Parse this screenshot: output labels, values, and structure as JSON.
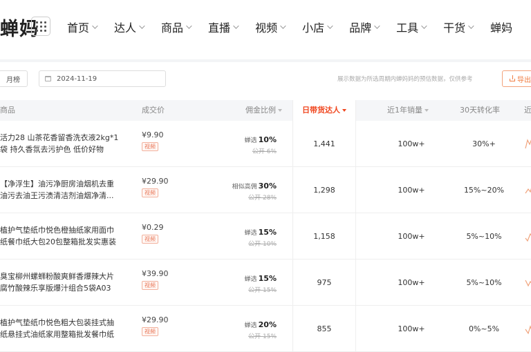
{
  "header": {
    "logo": "蝉妈",
    "nav": [
      "首页",
      "达人",
      "商品",
      "直播",
      "视频",
      "小店",
      "品牌",
      "工具",
      "干货",
      "蝉妈"
    ]
  },
  "filters": {
    "period_button": "月榜",
    "date": "2024-11-19",
    "notice": "展示数据为所选周期内蝉妈妈的预估数据，仅供参考",
    "export_label": "导出"
  },
  "table": {
    "columns": {
      "product": "商品",
      "price": "成交价",
      "commission": "佣金比例",
      "daily_creators": "日带货达人",
      "sales_1y": "近1年销量",
      "conversion_30d": "30天转化率",
      "trend": "近"
    },
    "rows": [
      {
        "name_line1": "活力28 山茶花香留香洗衣液2kg*1",
        "name_line2": "袋 持久香氛去污护色 低价好物",
        "price": "¥9.90",
        "tag": "视频",
        "commission_label": "蝉选",
        "commission_value": "10%",
        "commission_old": "公开 6%",
        "creators": "1,441",
        "sales": "100w+",
        "conversion": "30%+",
        "trend_color": "#f0a37c"
      },
      {
        "name_line1": "【净浮生】油污净厨房油烟机去重",
        "name_line2": "油污去油王污渍清洁剂油烟净清...",
        "price": "¥29.90",
        "tag": "视频",
        "commission_label": "相似高佣",
        "commission_value": "30%",
        "commission_old": "公开 28%",
        "creators": "1,298",
        "sales": "100w+",
        "conversion": "15%~20%",
        "trend_color": "#f0a37c"
      },
      {
        "name_line1": "植护气垫纸巾悦色橙抽纸家用面巾",
        "name_line2": "纸餐巾纸大包20包整箱批发实惠装",
        "price": "¥0.29",
        "tag": "视频",
        "commission_label": "蝉选",
        "commission_value": "15%",
        "commission_old": "公开 10%",
        "creators": "1,158",
        "sales": "100w+",
        "conversion": "5%~10%",
        "trend_color": "#f0a37c"
      },
      {
        "name_line1": "臭宝柳州螺蛳粉酸爽鲜香爆辣大片",
        "name_line2": "腐竹酸辣乐享版爆汁组合5袋A03",
        "price": "¥39.90",
        "tag": "视频",
        "commission_label": "蝉选",
        "commission_value": "15%",
        "commission_old": "公开 15%",
        "creators": "975",
        "sales": "100w+",
        "conversion": "5%~10%",
        "trend_color": "#f0a37c"
      },
      {
        "name_line1": "植护气垫纸巾悦色粗大包装挂式抽",
        "name_line2": "纸悬挂式油纸家用整箱批发餐巾纸",
        "price": "¥29.90",
        "tag": "视频",
        "commission_label": "蝉选",
        "commission_value": "20%",
        "commission_old": "公开 15%",
        "creators": "855",
        "sales": "100w+",
        "conversion": "0%~5%",
        "trend_color": "#f0a37c"
      }
    ]
  },
  "colors": {
    "accent": "#f0461e",
    "export": "#f07b3f",
    "tag": "#e9795a"
  }
}
